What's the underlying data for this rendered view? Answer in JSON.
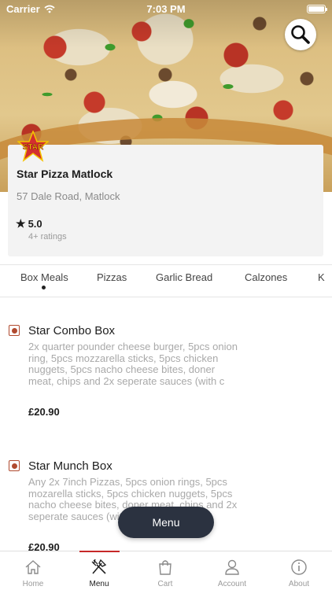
{
  "status_bar": {
    "carrier": "Carrier",
    "time": "7:03 PM"
  },
  "header": {
    "search_icon": "search-icon"
  },
  "restaurant": {
    "logo_text": "STAR",
    "logo_subtext": "PIZZA",
    "name": "Star Pizza Matlock",
    "address": "57 Dale Road, Matlock",
    "rating": "5.0",
    "rating_count": "4+ ratings"
  },
  "tabs": [
    {
      "label": "Box Meals",
      "active": true
    },
    {
      "label": "Pizzas"
    },
    {
      "label": "Garlic Bread"
    },
    {
      "label": "Calzones"
    },
    {
      "label": "K"
    }
  ],
  "menu_items": [
    {
      "title": "Star Combo Box",
      "description": "2x quarter pounder cheese burger, 5pcs onion ring, 5pcs mozzarella sticks, 5pcs chicken nuggets, 5pcs nacho cheese bites, doner meat, chips and 2x seperate sauces (with c",
      "price": "£20.90"
    },
    {
      "title": "Star Munch Box",
      "description": "Any 2x 7inch Pizzas, 5pcs onion rings, 5pcs mozarella sticks, 5pcs chicken nuggets, 5pcs nacho cheese bites, doner meat, chips and 2x seperate sauces (with choice)",
      "price": "£20.90"
    }
  ],
  "menu_button": {
    "label": "Menu"
  },
  "bottom_nav": [
    {
      "label": "Home",
      "icon": "home-icon"
    },
    {
      "label": "Menu",
      "icon": "fork-knife-icon",
      "active": true
    },
    {
      "label": "Cart",
      "icon": "bag-icon"
    },
    {
      "label": "Account",
      "icon": "account-icon"
    },
    {
      "label": "About",
      "icon": "info-icon"
    }
  ],
  "colors": {
    "accent": "#c62828",
    "fab": "#2b3240",
    "checkbox": "#b04a2f"
  }
}
